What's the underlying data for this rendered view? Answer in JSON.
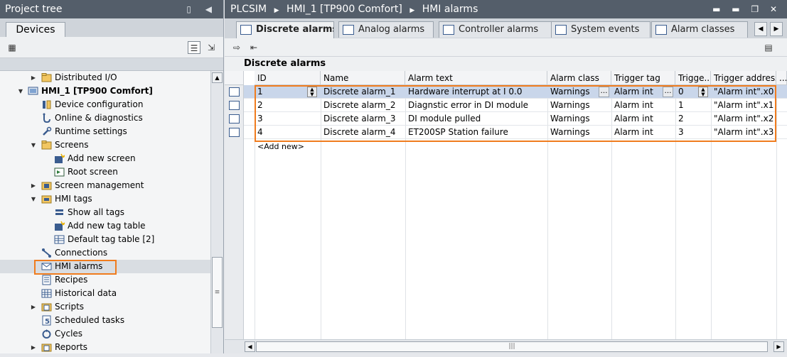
{
  "left_panel": {
    "title": "Project tree",
    "tab": "Devices",
    "tree": [
      {
        "label": "Distributed I/O",
        "icon": "folder-icon",
        "arrow": "right"
      },
      {
        "label": "HMI_1 [TP900 Comfort]",
        "icon": "hmi-device-icon",
        "arrow": "down",
        "bold": true
      },
      {
        "label": "Device configuration",
        "icon": "device-config-icon"
      },
      {
        "label": "Online & diagnostics",
        "icon": "online-diagnostics-icon"
      },
      {
        "label": "Runtime settings",
        "icon": "runtime-settings-icon"
      },
      {
        "label": "Screens",
        "icon": "folder-icon",
        "arrow": "down"
      },
      {
        "label": "Add new screen",
        "icon": "add-new-icon"
      },
      {
        "label": "Root screen",
        "icon": "screen-icon"
      },
      {
        "label": "Screen management",
        "icon": "folder-icon",
        "arrow": "right"
      },
      {
        "label": "HMI tags",
        "icon": "folder-icon",
        "arrow": "down"
      },
      {
        "label": "Show all tags",
        "icon": "tags-icon"
      },
      {
        "label": "Add new tag table",
        "icon": "add-new-icon"
      },
      {
        "label": "Default tag table [2]",
        "icon": "tag-table-icon"
      },
      {
        "label": "Connections",
        "icon": "connections-icon"
      },
      {
        "label": "HMI alarms",
        "icon": "alarm-icon",
        "selected": true
      },
      {
        "label": "Recipes",
        "icon": "recipes-icon"
      },
      {
        "label": "Historical data",
        "icon": "historical-data-icon"
      },
      {
        "label": "Scripts",
        "icon": "folder-icon",
        "arrow": "right"
      },
      {
        "label": "Scheduled tasks",
        "icon": "scheduled-tasks-icon"
      },
      {
        "label": "Cycles",
        "icon": "cycles-icon"
      },
      {
        "label": "Reports",
        "icon": "folder-icon",
        "arrow": "right"
      }
    ]
  },
  "editor": {
    "breadcrumb": [
      "PLCSIM",
      "HMI_1 [TP900 Comfort]",
      "HMI alarms"
    ],
    "tabs": [
      {
        "label": "Discrete alarms",
        "active": true
      },
      {
        "label": "Analog alarms"
      },
      {
        "label": "Controller alarms"
      },
      {
        "label": "System events"
      },
      {
        "label": "Alarm classes"
      }
    ],
    "section_title": "Discrete alarms",
    "columns": [
      "ID",
      "Name",
      "Alarm text",
      "Alarm class",
      "Trigger tag",
      "Trigge...",
      "Trigger address",
      "..."
    ],
    "rows": [
      {
        "id": "1",
        "name": "Discrete alarm_1",
        "text": "Hardware interrupt at I 0.0",
        "class": "Warnings",
        "tag": "Alarm int",
        "bit": "0",
        "address": "\"Alarm int\".x0"
      },
      {
        "id": "2",
        "name": "Discrete alarm_2",
        "text": "Diagnstic error in DI module",
        "class": "Warnings",
        "tag": "Alarm int",
        "bit": "1",
        "address": "\"Alarm int\".x1"
      },
      {
        "id": "3",
        "name": "Discrete alarm_3",
        "text": "DI module pulled",
        "class": "Warnings",
        "tag": "Alarm int",
        "bit": "2",
        "address": "\"Alarm int\".x2"
      },
      {
        "id": "4",
        "name": "Discrete alarm_4",
        "text": "ET200SP Station failure",
        "class": "Warnings",
        "tag": "Alarm int",
        "bit": "3",
        "address": "\"Alarm int\".x3"
      }
    ],
    "add_new": "<Add new>"
  },
  "colors": {
    "highlight": "#f07c1e",
    "title_bar": "#545e6a",
    "selected_row": "#c9d6ea"
  }
}
